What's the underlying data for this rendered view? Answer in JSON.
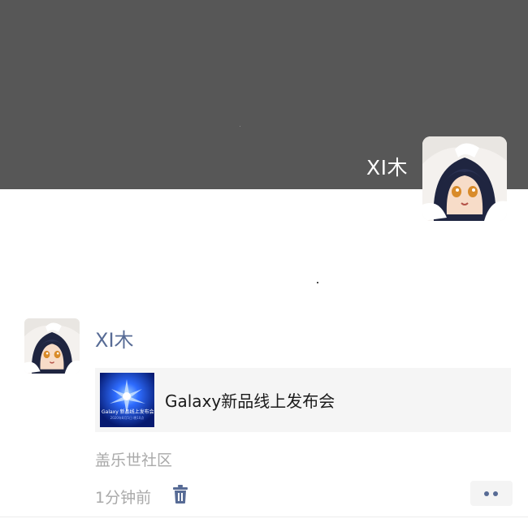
{
  "profile": {
    "name": "XI木",
    "avatar_icon": "anime-girl-avatar"
  },
  "post": {
    "author": "XI木",
    "avatar_icon": "anime-girl-avatar",
    "share": {
      "title": "Galaxy新品线上发布会",
      "thumb_icon": "galaxy-event-thumbnail",
      "thumb_title": "Galaxy 新品线上发布会",
      "thumb_sub": "2020年8月5日 晚10点"
    },
    "source": "盖乐世社区",
    "time": "1分钟前",
    "delete_icon": "trash-icon",
    "more_icon": "more-dots-icon"
  },
  "colors": {
    "cover": "#575757",
    "link": "#576b95",
    "meta": "#a9a9a9",
    "card": "#f5f5f5"
  }
}
